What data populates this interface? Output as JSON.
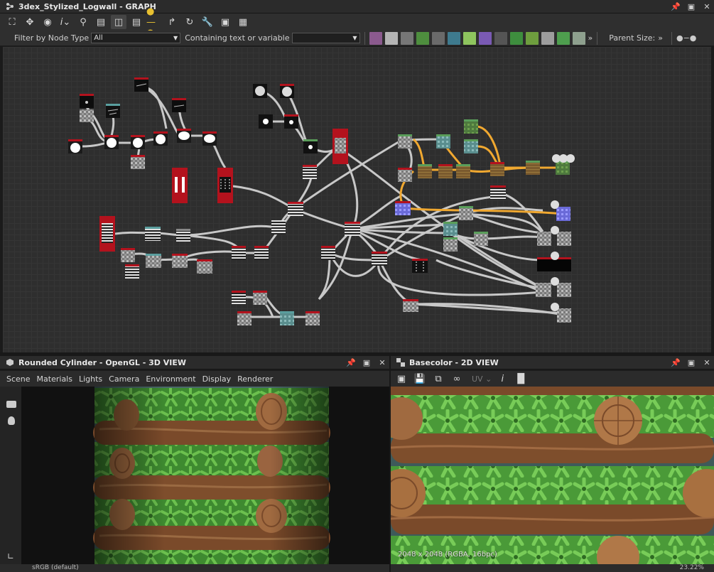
{
  "graph_panel": {
    "title": "3dex_Stylized_Logwall - GRAPH",
    "filter_label": "Filter by Node Type",
    "filter_value": "All",
    "contains_label": "Containing text or variable",
    "contains_value": "",
    "parent_size_label": "Parent Size:",
    "toolbar_icons": [
      "frame-all-icon",
      "pan-icon",
      "screenshot-icon",
      "info-icon",
      "search-icon",
      "align-icon",
      "layout-icon",
      "stack-icon",
      "link-icon",
      "connect-icon",
      "refresh-icon",
      "tools-icon",
      "frame-icon",
      "grid-icon"
    ],
    "filter_icons": [
      {
        "name": "image-filter-icon",
        "color": "#8b5a8e"
      },
      {
        "name": "page-filter-icon",
        "color": "#b4b4b4"
      },
      {
        "name": "drop-filter-icon",
        "color": "#777777"
      },
      {
        "name": "curve-filter-icon",
        "color": "#4e8e3e"
      },
      {
        "name": "gradient-filter-icon",
        "color": "#6a6a6a"
      },
      {
        "name": "pattern-filter-icon",
        "color": "#3e7a8e"
      },
      {
        "name": "transform-filter-icon",
        "color": "#8ec45e"
      },
      {
        "name": "blur-filter-icon",
        "color": "#7a5ab4"
      },
      {
        "name": "grid-filter-icon",
        "color": "#555555"
      },
      {
        "name": "import-filter-icon",
        "color": "#3e8e3e"
      },
      {
        "name": "paint-filter-icon",
        "color": "#6e9e3e"
      },
      {
        "name": "swatch-filter-icon",
        "color": "#9e9e9e"
      },
      {
        "name": "mix-filter-icon",
        "color": "#4e9e4e"
      },
      {
        "name": "levels-filter-icon",
        "color": "#8ea08e"
      }
    ]
  },
  "view3d_panel": {
    "title": "Rounded Cylinder - OpenGL - 3D VIEW",
    "menu": [
      "Scene",
      "Materials",
      "Lights",
      "Camera",
      "Environment",
      "Display",
      "Renderer"
    ],
    "colorspace": "sRGB (default)"
  },
  "view2d_panel": {
    "title": "Basecolor - 2D VIEW",
    "uv_label": "UV",
    "info": "2048 x 2048 (RGBA, 16bpc)",
    "zoom": "23.22%"
  },
  "colors": {
    "wire_gray": "#c8c8c8",
    "wire_orange": "#f0a830",
    "node_red": "#b3121d",
    "wood": "#7a4a2a",
    "foliage": "#4ea53b"
  }
}
